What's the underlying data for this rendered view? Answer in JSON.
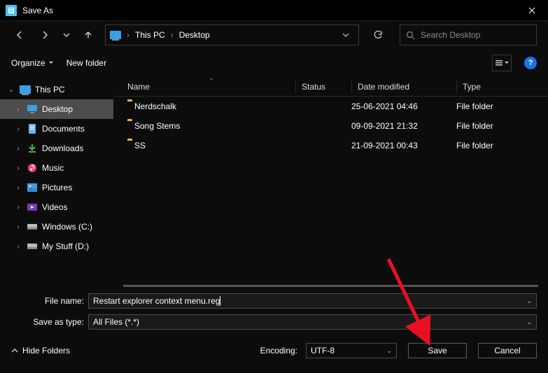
{
  "window": {
    "title": "Save As"
  },
  "address": {
    "crumbs": [
      "This PC",
      "Desktop"
    ]
  },
  "search": {
    "placeholder": "Search Desktop"
  },
  "toolbar": {
    "organize_label": "Organize",
    "newfolder_label": "New folder"
  },
  "tree": {
    "root": "This PC",
    "items": [
      {
        "label": "Desktop",
        "icon": "desktop",
        "selected": true
      },
      {
        "label": "Documents",
        "icon": "doc"
      },
      {
        "label": "Downloads",
        "icon": "download"
      },
      {
        "label": "Music",
        "icon": "music"
      },
      {
        "label": "Pictures",
        "icon": "pictures"
      },
      {
        "label": "Videos",
        "icon": "videos"
      },
      {
        "label": "Windows (C:)",
        "icon": "disk"
      },
      {
        "label": "My Stuff (D:)",
        "icon": "disk"
      }
    ]
  },
  "columns": {
    "name": "Name",
    "status": "Status",
    "date": "Date modified",
    "type": "Type"
  },
  "rows": [
    {
      "name": "Nerdschalk",
      "date": "25-06-2021 04:46",
      "type": "File folder"
    },
    {
      "name": "Song Stems",
      "date": "09-09-2021 21:32",
      "type": "File folder"
    },
    {
      "name": "SS",
      "date": "21-09-2021 00:43",
      "type": "File folder"
    }
  ],
  "fields": {
    "filename_label": "File name:",
    "filename_value": "Restart explorer context menu.reg",
    "saveastype_label": "Save as type:",
    "saveastype_value": "All Files  (*.*)"
  },
  "footer": {
    "hidefolders_label": "Hide Folders",
    "encoding_label": "Encoding:",
    "encoding_value": "UTF-8",
    "save_label": "Save",
    "cancel_label": "Cancel"
  },
  "help_glyph": "?"
}
